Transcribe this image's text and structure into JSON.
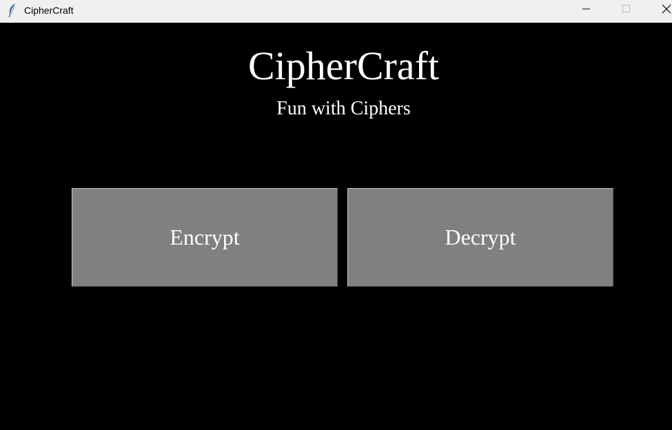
{
  "window": {
    "title": "CipherCraft",
    "icon": "feather-icon",
    "controls": {
      "minimize_icon": "minimize-icon",
      "maximize_icon": "maximize-icon",
      "close_icon": "close-icon"
    }
  },
  "main": {
    "title": "CipherCraft",
    "subtitle": "Fun with Ciphers",
    "buttons": {
      "encrypt_label": "Encrypt",
      "decrypt_label": "Decrypt"
    }
  },
  "colors": {
    "background": "#000000",
    "button_bg": "#808080",
    "text": "#ffffff",
    "titlebar": "#f0f0f0"
  }
}
